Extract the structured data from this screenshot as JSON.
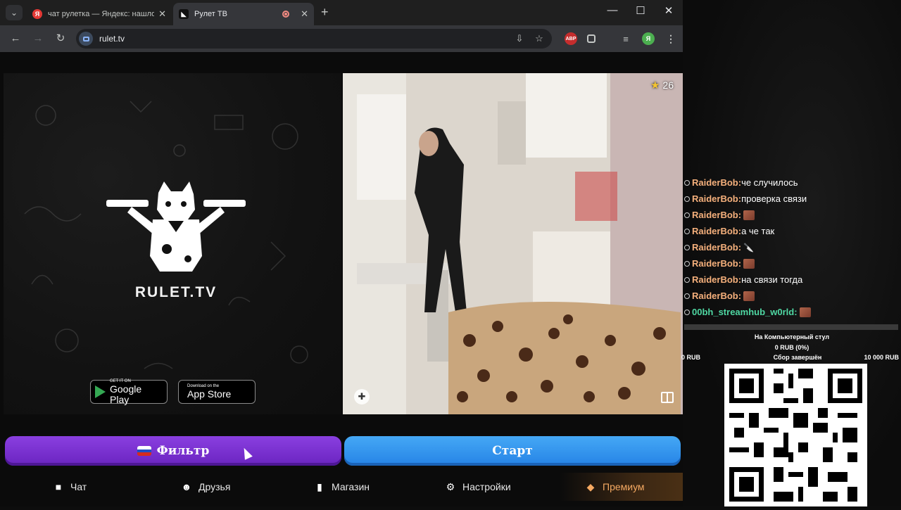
{
  "browser": {
    "tabs": [
      {
        "title": "чат рулетка — Яндекс: нашло",
        "favicon": "Я"
      },
      {
        "title": "Рулет ТВ",
        "favicon": "◣"
      }
    ],
    "url": "rulet.tv",
    "profile_initial": "Я",
    "adblock_label": "ABP"
  },
  "page": {
    "brand": "RULET.TV",
    "google_play": {
      "small": "GET IT ON",
      "large": "Google Play"
    },
    "app_store": {
      "small": "Download on the",
      "large": "App Store"
    },
    "video": {
      "rating": "26"
    },
    "filter_button": "Фильтр",
    "start_button": "Старт",
    "nav": {
      "chat": "Чат",
      "friends": "Друзья",
      "shop": "Магазин",
      "settings": "Настройки",
      "premium": "Премиум"
    }
  },
  "overlay": {
    "chat": [
      {
        "user": "RaiderBob:",
        "text": "че случилось"
      },
      {
        "user": "RaiderBob:",
        "text": "проверка связи"
      },
      {
        "user": "RaiderBob:",
        "text": ""
      },
      {
        "user": "RaiderBob:",
        "text": "а че так"
      },
      {
        "user": "RaiderBob:",
        "text": ""
      },
      {
        "user": "RaiderBob:",
        "text": ""
      },
      {
        "user": "RaiderBob:",
        "text": "на связи тогда"
      },
      {
        "user": "RaiderBob:",
        "text": ""
      },
      {
        "user": "00bh_streamhub_w0rld:",
        "text": ""
      }
    ],
    "goal": {
      "title": "На Компьютерный стул",
      "amount": "0 RUB (0%)",
      "min": "0 RUB",
      "status": "Сбор завершён",
      "max": "10 000 RUB"
    }
  },
  "colors": {
    "filter": "#7a30d0",
    "start": "#3597ef",
    "premium": "#f5a962",
    "chat_user": "#f5b07c",
    "chat_user_alt": "#4fd8a3"
  }
}
